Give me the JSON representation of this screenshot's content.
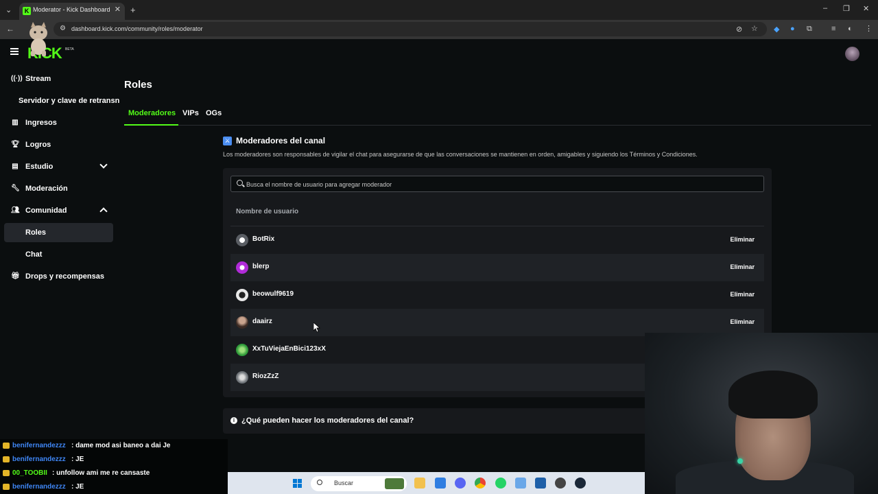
{
  "browser": {
    "tab_title": "Moderator - Kick Dashboard",
    "tab_icon_letter": "K",
    "url": "dashboard.kick.com/community/roles/moderator"
  },
  "app": {
    "logo": "KICK",
    "logo_badge": "BETA"
  },
  "sidebar": {
    "items": [
      {
        "label": "Stream",
        "icon": "broadcast-icon"
      },
      {
        "label": "Servidor y clave de retransn",
        "icon": ""
      },
      {
        "label": "Ingresos",
        "icon": "chart-icon"
      },
      {
        "label": "Logros",
        "icon": "trophy-icon"
      },
      {
        "label": "Estudio",
        "icon": "studio-icon"
      },
      {
        "label": "Moderación",
        "icon": "wrench-icon"
      },
      {
        "label": "Comunidad",
        "icon": "community-icon"
      },
      {
        "label": "Roles",
        "icon": ""
      },
      {
        "label": "Chat",
        "icon": ""
      },
      {
        "label": "Drops y recompensas",
        "icon": "gift-icon"
      }
    ]
  },
  "main": {
    "title": "Roles",
    "tabs": [
      "Moderadores",
      "VIPs",
      "OGs"
    ],
    "section_title": "Moderadores del canal",
    "section_desc": "Los moderadores son responsables de vigilar el chat para asegurarse de que las conversaciones se mantienen en orden, amigables y siguiendo los Términos y Condiciones.",
    "search_placeholder": "Busca el nombre de usuario para agregar moderador",
    "column_header": "Nombre de usuario",
    "remove_label": "Eliminar",
    "moderators": [
      "BotRix",
      "blerp",
      "beowulf9619",
      "daairz",
      "XxTuViejaEnBici123xX",
      "RiozZzZ"
    ],
    "faq": "¿Qué pueden hacer los moderadores del canal?"
  },
  "chat_overlay": [
    {
      "user": "benifernandezzz",
      "msg": ": dame mod asi baneo a dai Je"
    },
    {
      "user": "benifernandezzz",
      "msg": ": JE"
    },
    {
      "user": "00_TOOBII",
      "msg": ": unfollow ami me re cansaste"
    },
    {
      "user": "benifernandezzz",
      "msg": ": JE"
    }
  ],
  "taskbar": {
    "search_label": "Buscar"
  },
  "colors": {
    "accent": "#53fc18",
    "info_blue": "#4b8ef1",
    "chat_user": "#3f86f5"
  }
}
